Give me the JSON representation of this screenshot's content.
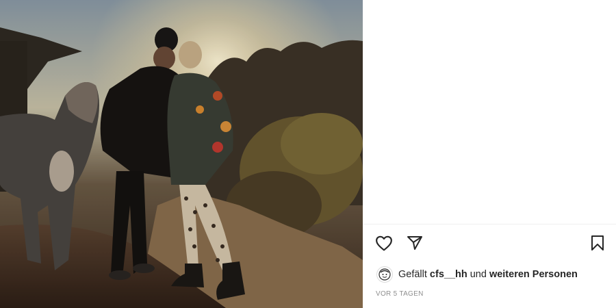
{
  "post": {
    "actions": {
      "like_icon": "heart-outline-icon",
      "share_icon": "paper-plane-icon",
      "save_icon": "bookmark-outline-icon"
    },
    "likes": {
      "prefix": "Gefällt",
      "user": "cfs__hh",
      "connector": "und",
      "others": "weiteren Personen"
    },
    "timestamp": "VOR 5 TAGEN"
  }
}
